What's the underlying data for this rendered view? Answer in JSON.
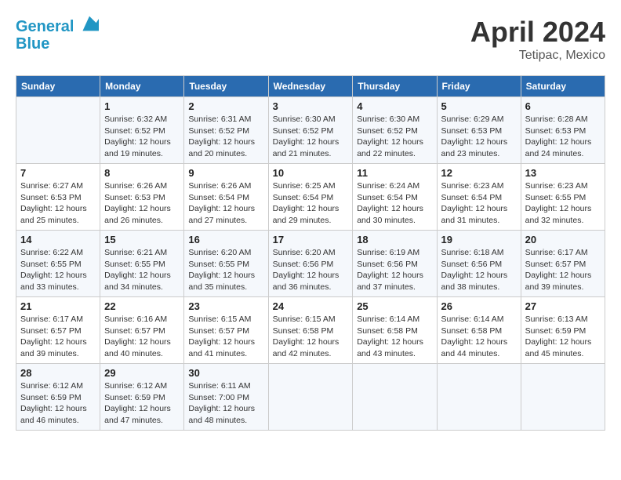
{
  "header": {
    "logo_line1": "General",
    "logo_line2": "Blue",
    "month_title": "April 2024",
    "location": "Tetipac, Mexico"
  },
  "weekdays": [
    "Sunday",
    "Monday",
    "Tuesday",
    "Wednesday",
    "Thursday",
    "Friday",
    "Saturday"
  ],
  "weeks": [
    [
      {
        "day": "",
        "sunrise": "",
        "sunset": "",
        "daylight": ""
      },
      {
        "day": "1",
        "sunrise": "Sunrise: 6:32 AM",
        "sunset": "Sunset: 6:52 PM",
        "daylight": "Daylight: 12 hours and 19 minutes."
      },
      {
        "day": "2",
        "sunrise": "Sunrise: 6:31 AM",
        "sunset": "Sunset: 6:52 PM",
        "daylight": "Daylight: 12 hours and 20 minutes."
      },
      {
        "day": "3",
        "sunrise": "Sunrise: 6:30 AM",
        "sunset": "Sunset: 6:52 PM",
        "daylight": "Daylight: 12 hours and 21 minutes."
      },
      {
        "day": "4",
        "sunrise": "Sunrise: 6:30 AM",
        "sunset": "Sunset: 6:52 PM",
        "daylight": "Daylight: 12 hours and 22 minutes."
      },
      {
        "day": "5",
        "sunrise": "Sunrise: 6:29 AM",
        "sunset": "Sunset: 6:53 PM",
        "daylight": "Daylight: 12 hours and 23 minutes."
      },
      {
        "day": "6",
        "sunrise": "Sunrise: 6:28 AM",
        "sunset": "Sunset: 6:53 PM",
        "daylight": "Daylight: 12 hours and 24 minutes."
      }
    ],
    [
      {
        "day": "7",
        "sunrise": "Sunrise: 6:27 AM",
        "sunset": "Sunset: 6:53 PM",
        "daylight": "Daylight: 12 hours and 25 minutes."
      },
      {
        "day": "8",
        "sunrise": "Sunrise: 6:26 AM",
        "sunset": "Sunset: 6:53 PM",
        "daylight": "Daylight: 12 hours and 26 minutes."
      },
      {
        "day": "9",
        "sunrise": "Sunrise: 6:26 AM",
        "sunset": "Sunset: 6:54 PM",
        "daylight": "Daylight: 12 hours and 27 minutes."
      },
      {
        "day": "10",
        "sunrise": "Sunrise: 6:25 AM",
        "sunset": "Sunset: 6:54 PM",
        "daylight": "Daylight: 12 hours and 29 minutes."
      },
      {
        "day": "11",
        "sunrise": "Sunrise: 6:24 AM",
        "sunset": "Sunset: 6:54 PM",
        "daylight": "Daylight: 12 hours and 30 minutes."
      },
      {
        "day": "12",
        "sunrise": "Sunrise: 6:23 AM",
        "sunset": "Sunset: 6:54 PM",
        "daylight": "Daylight: 12 hours and 31 minutes."
      },
      {
        "day": "13",
        "sunrise": "Sunrise: 6:23 AM",
        "sunset": "Sunset: 6:55 PM",
        "daylight": "Daylight: 12 hours and 32 minutes."
      }
    ],
    [
      {
        "day": "14",
        "sunrise": "Sunrise: 6:22 AM",
        "sunset": "Sunset: 6:55 PM",
        "daylight": "Daylight: 12 hours and 33 minutes."
      },
      {
        "day": "15",
        "sunrise": "Sunrise: 6:21 AM",
        "sunset": "Sunset: 6:55 PM",
        "daylight": "Daylight: 12 hours and 34 minutes."
      },
      {
        "day": "16",
        "sunrise": "Sunrise: 6:20 AM",
        "sunset": "Sunset: 6:55 PM",
        "daylight": "Daylight: 12 hours and 35 minutes."
      },
      {
        "day": "17",
        "sunrise": "Sunrise: 6:20 AM",
        "sunset": "Sunset: 6:56 PM",
        "daylight": "Daylight: 12 hours and 36 minutes."
      },
      {
        "day": "18",
        "sunrise": "Sunrise: 6:19 AM",
        "sunset": "Sunset: 6:56 PM",
        "daylight": "Daylight: 12 hours and 37 minutes."
      },
      {
        "day": "19",
        "sunrise": "Sunrise: 6:18 AM",
        "sunset": "Sunset: 6:56 PM",
        "daylight": "Daylight: 12 hours and 38 minutes."
      },
      {
        "day": "20",
        "sunrise": "Sunrise: 6:17 AM",
        "sunset": "Sunset: 6:57 PM",
        "daylight": "Daylight: 12 hours and 39 minutes."
      }
    ],
    [
      {
        "day": "21",
        "sunrise": "Sunrise: 6:17 AM",
        "sunset": "Sunset: 6:57 PM",
        "daylight": "Daylight: 12 hours and 39 minutes."
      },
      {
        "day": "22",
        "sunrise": "Sunrise: 6:16 AM",
        "sunset": "Sunset: 6:57 PM",
        "daylight": "Daylight: 12 hours and 40 minutes."
      },
      {
        "day": "23",
        "sunrise": "Sunrise: 6:15 AM",
        "sunset": "Sunset: 6:57 PM",
        "daylight": "Daylight: 12 hours and 41 minutes."
      },
      {
        "day": "24",
        "sunrise": "Sunrise: 6:15 AM",
        "sunset": "Sunset: 6:58 PM",
        "daylight": "Daylight: 12 hours and 42 minutes."
      },
      {
        "day": "25",
        "sunrise": "Sunrise: 6:14 AM",
        "sunset": "Sunset: 6:58 PM",
        "daylight": "Daylight: 12 hours and 43 minutes."
      },
      {
        "day": "26",
        "sunrise": "Sunrise: 6:14 AM",
        "sunset": "Sunset: 6:58 PM",
        "daylight": "Daylight: 12 hours and 44 minutes."
      },
      {
        "day": "27",
        "sunrise": "Sunrise: 6:13 AM",
        "sunset": "Sunset: 6:59 PM",
        "daylight": "Daylight: 12 hours and 45 minutes."
      }
    ],
    [
      {
        "day": "28",
        "sunrise": "Sunrise: 6:12 AM",
        "sunset": "Sunset: 6:59 PM",
        "daylight": "Daylight: 12 hours and 46 minutes."
      },
      {
        "day": "29",
        "sunrise": "Sunrise: 6:12 AM",
        "sunset": "Sunset: 6:59 PM",
        "daylight": "Daylight: 12 hours and 47 minutes."
      },
      {
        "day": "30",
        "sunrise": "Sunrise: 6:11 AM",
        "sunset": "Sunset: 7:00 PM",
        "daylight": "Daylight: 12 hours and 48 minutes."
      },
      {
        "day": "",
        "sunrise": "",
        "sunset": "",
        "daylight": ""
      },
      {
        "day": "",
        "sunrise": "",
        "sunset": "",
        "daylight": ""
      },
      {
        "day": "",
        "sunrise": "",
        "sunset": "",
        "daylight": ""
      },
      {
        "day": "",
        "sunrise": "",
        "sunset": "",
        "daylight": ""
      }
    ]
  ]
}
